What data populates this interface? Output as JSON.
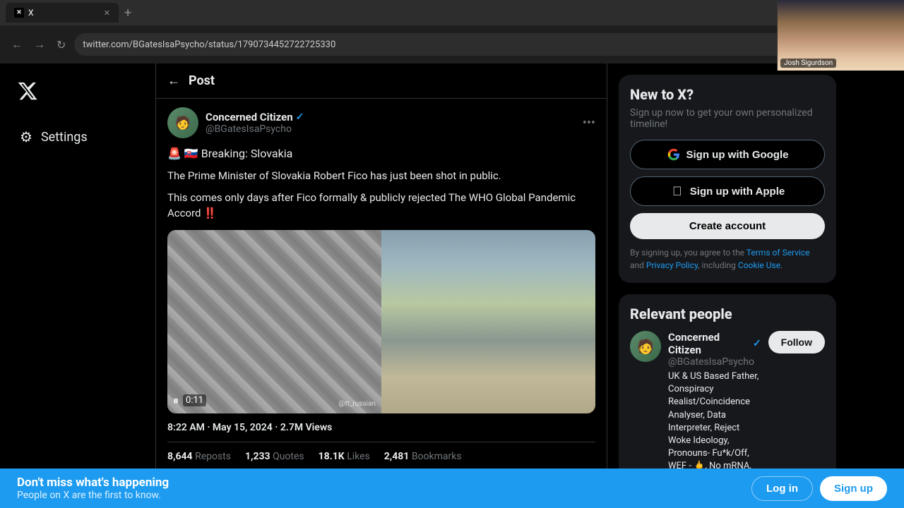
{
  "browser": {
    "url": "twitter.com/BGatesIsaPsycho/status/1790734452722725330",
    "tab_label": "X",
    "tab_favicon": "X"
  },
  "sidebar": {
    "logo_alt": "X logo",
    "items": [
      {
        "id": "settings",
        "label": "Settings",
        "icon": "⚙"
      }
    ]
  },
  "post": {
    "header": "Post",
    "author": {
      "display_name": "Concerned Citizen",
      "handle": "@BGatesIsaPsycho",
      "verified": true
    },
    "text_line1": "🚨 🇸🇰 Breaking: Slovakia",
    "text_line2": "The Prime Minister of Slovakia Robert Fico has just been shot in public.",
    "text_line3": "This comes only days after Fico formally & publicly rejected The WHO Global Pandemic Accord ‼️",
    "video_time": "0:11",
    "timestamp": "8:22 AM · May 15, 2024 · ",
    "views": "2.7M",
    "views_label": "Views",
    "stats": [
      {
        "count": "8,644",
        "label": "Reposts"
      },
      {
        "count": "1,233",
        "label": "Quotes"
      },
      {
        "count": "18.1K",
        "label": "Likes"
      },
      {
        "count": "2,481",
        "label": "Bookmarks"
      }
    ]
  },
  "new_to_x": {
    "title": "New to X?",
    "subtitle": "Sign up now to get your own personalized timeline!",
    "google_btn": "Sign up with Google",
    "apple_btn": "Sign up with Apple",
    "create_btn": "Create account",
    "tos_prefix": "By signing up, you agree to the ",
    "tos_link": "Terms of Service",
    "tos_and": " and ",
    "privacy_link": "Privacy Policy",
    "tos_suffix": ", including ",
    "cookie_link": "Cookie Use",
    "tos_end": "."
  },
  "relevant_people": {
    "title": "Relevant people",
    "person": {
      "display_name": "Concerned Citizen",
      "handle": "@BGatesIsaPsycho",
      "verified": true,
      "bio": "UK & US Based Father, Conspiracy Realist/Coincidence Analyser, Data Interpreter, Reject Woke Ideology, Pronouns- Fu*k/Off, WEF - 🖕, No mRNA, STOP GeoEngineering",
      "follow_label": "Follow"
    }
  },
  "bottom_banner": {
    "main_text": "Don't miss what's happening",
    "sub_text": "People on X are the first to know.",
    "login_label": "Log in",
    "signup_label": "Sign up"
  },
  "webcam": {
    "label": "Josh Sigurdson"
  }
}
